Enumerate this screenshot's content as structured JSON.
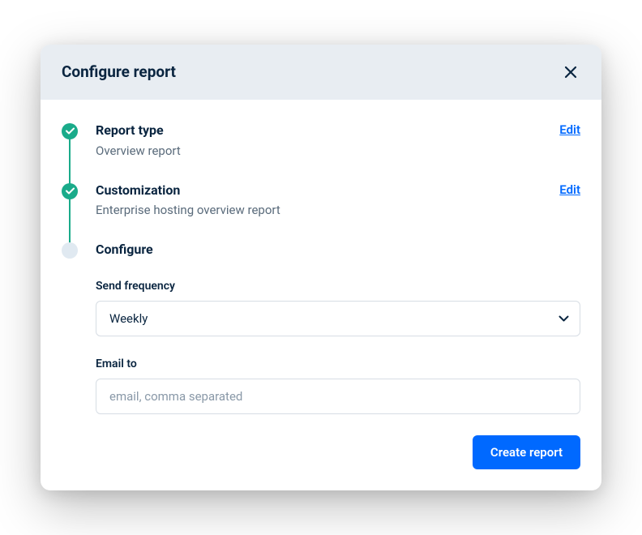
{
  "modal": {
    "title": "Configure report"
  },
  "steps": {
    "report_type": {
      "title": "Report type",
      "subtitle": "Overview report",
      "edit_label": "Edit"
    },
    "customization": {
      "title": "Customization",
      "subtitle": "Enterprise hosting overview report",
      "edit_label": "Edit"
    },
    "configure": {
      "title": "Configure"
    }
  },
  "form": {
    "frequency": {
      "label": "Send frequency",
      "value": "Weekly"
    },
    "email": {
      "label": "Email to",
      "placeholder": "email, comma separated"
    }
  },
  "footer": {
    "submit_label": "Create report"
  }
}
